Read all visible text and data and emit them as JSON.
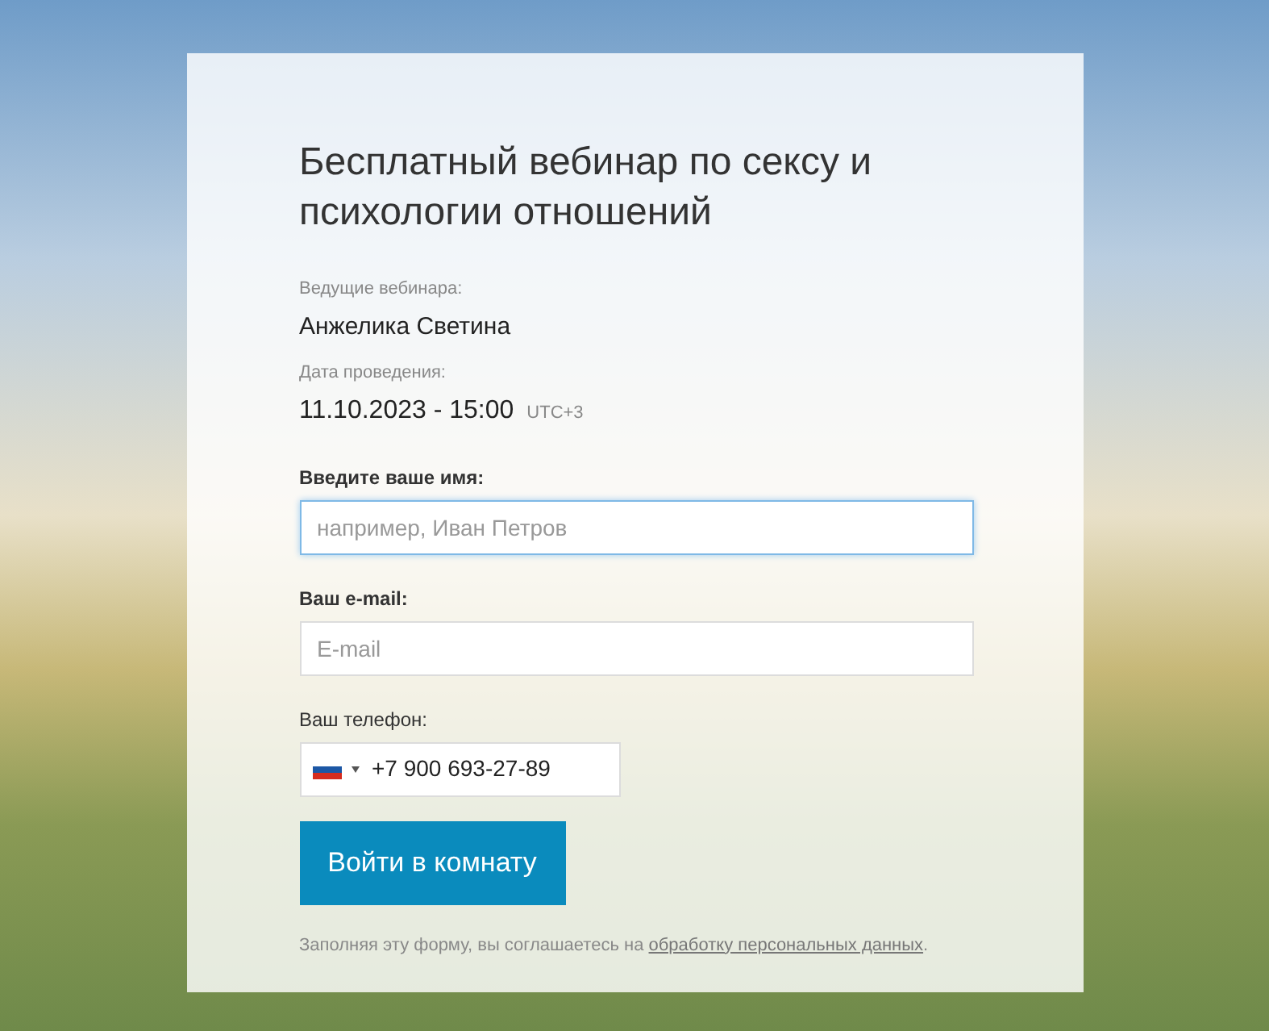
{
  "title": "Бесплатный вебинар по сексу и психологии отношений",
  "host": {
    "label": "Ведущие вебинара:",
    "value": "Анжелика Светина"
  },
  "date": {
    "label": "Дата проведения:",
    "value": "11.10.2023 - 15:00",
    "timezone": "UTC+3"
  },
  "fields": [
    {
      "kind": "text",
      "label": "Введите ваше имя:",
      "bold": true,
      "placeholder": "например, Иван Петров",
      "focused": true
    },
    {
      "kind": "text",
      "label": "Ваш e-mail:",
      "bold": true,
      "placeholder": "E-mail",
      "focused": false
    },
    {
      "kind": "phone",
      "label": "Ваш телефон:",
      "bold": false,
      "value": "+7 900 693-27-89",
      "focused": false
    }
  ],
  "submit": "Войти в комнату",
  "consent": {
    "text": "Заполняя эту форму, вы соглашаетесь на",
    "link": "обработку персональных данных",
    "end": "."
  }
}
